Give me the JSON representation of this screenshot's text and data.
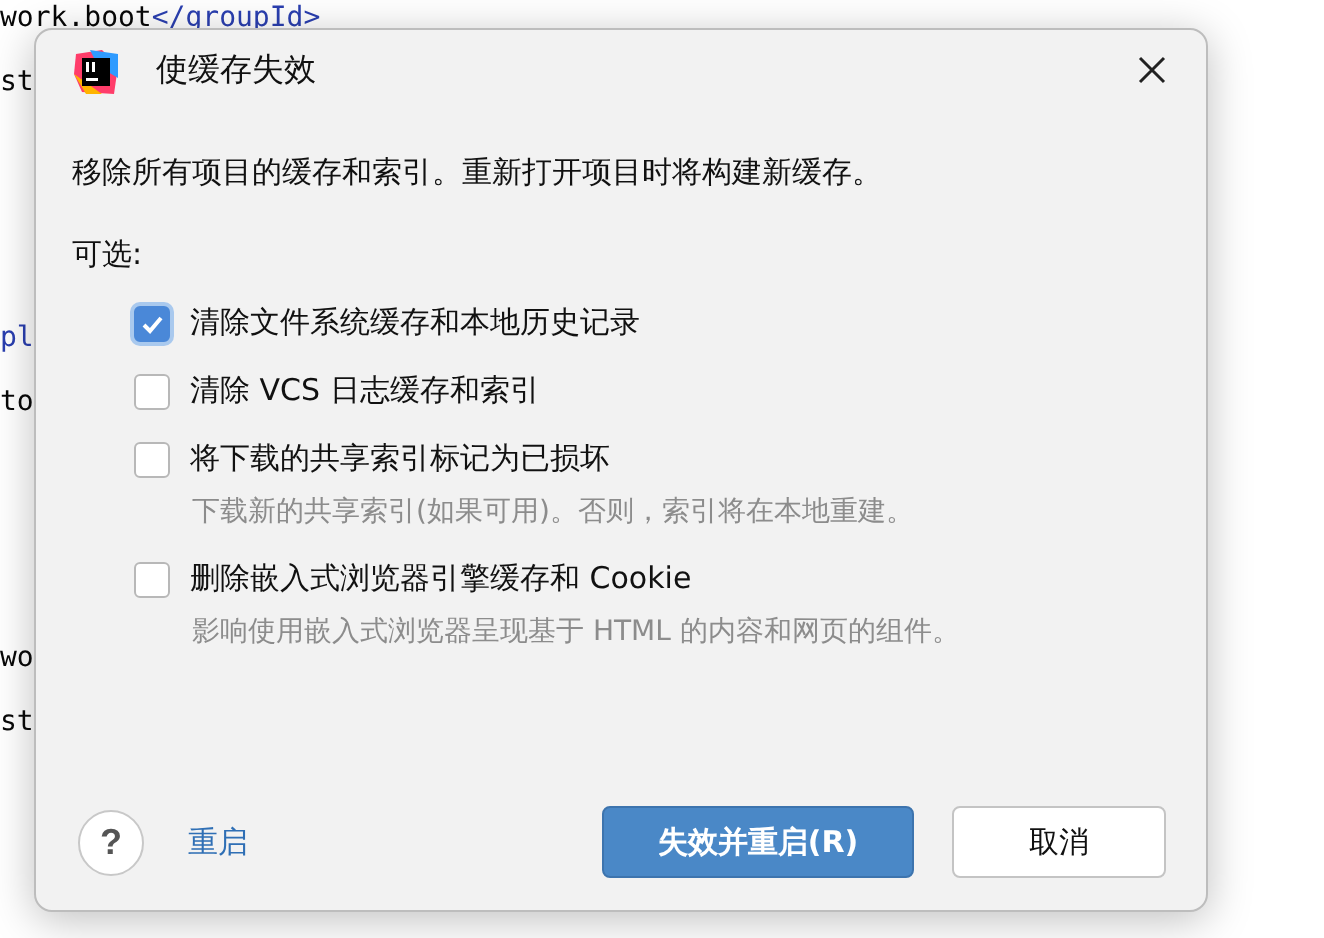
{
  "editor": {
    "lines": [
      {
        "kind": "code",
        "tokens": [
          {
            "text": "work.boot",
            "kind": "plain"
          },
          {
            "text": "</groupId>",
            "kind": "tag"
          }
        ]
      },
      {
        "kind": "code",
        "tokens": [
          {
            "text": "st",
            "kind": "plain"
          }
        ]
      },
      {
        "kind": "blank"
      },
      {
        "kind": "blank"
      },
      {
        "kind": "blank"
      },
      {
        "kind": "code",
        "tokens": [
          {
            "text": "pl",
            "kind": "tag"
          }
        ]
      },
      {
        "kind": "code",
        "tokens": [
          {
            "text": "to",
            "kind": "plain"
          }
        ]
      },
      {
        "kind": "blank"
      },
      {
        "kind": "blank"
      },
      {
        "kind": "blank"
      },
      {
        "kind": "code",
        "tokens": [
          {
            "text": "wo",
            "kind": "plain"
          }
        ]
      },
      {
        "kind": "code",
        "tokens": [
          {
            "text": "st",
            "kind": "plain"
          }
        ]
      }
    ]
  },
  "dialog": {
    "title": "使缓存失效",
    "description": "移除所有项目的缓存和索引。重新打开项目时将构建新缓存。",
    "options_label": "可选:",
    "options": [
      {
        "label": "清除文件系统缓存和本地历史记录",
        "checked": true
      },
      {
        "label": "清除 VCS 日志缓存和索引",
        "checked": false
      },
      {
        "label": "将下载的共享索引标记为已损坏",
        "checked": false,
        "hint": "下载新的共享索引(如果可用)。否则，索引将在本地重建。"
      },
      {
        "label": "删除嵌入式浏览器引擎缓存和 Cookie",
        "checked": false,
        "hint": "影响使用嵌入式浏览器呈现基于 HTML 的内容和网页的组件。"
      }
    ],
    "help": "?",
    "link": "重启",
    "primary_button": "失效并重启(R)",
    "cancel_button": "取消"
  }
}
